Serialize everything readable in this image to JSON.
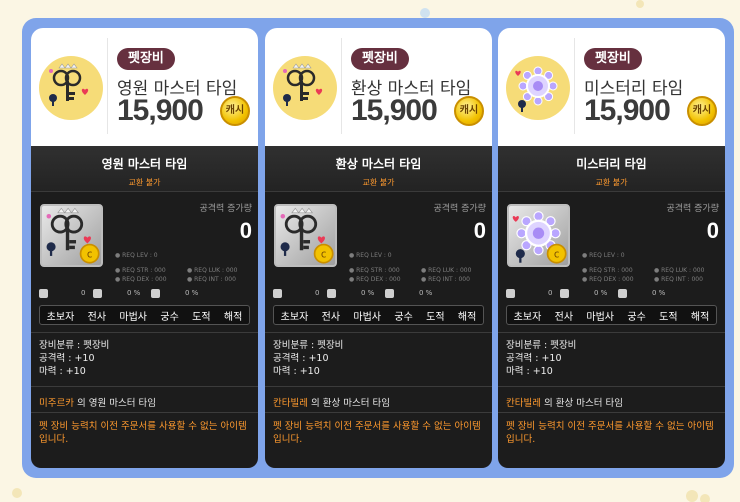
{
  "cards": [
    {
      "category": "펫장비",
      "item_name": "영원 마스터 타임",
      "price": "15,900",
      "currency": "캐시",
      "tooltip_name": "영원 마스터 타임",
      "trade": "교환 불가",
      "attack_label": "공격력 증가량",
      "attack_value": "0",
      "req_lev": "● REQ LEV :    0",
      "req_str": "● REQ STR : 000",
      "req_luk": "● REQ LUK : 000",
      "req_dex": "● REQ DEX : 000",
      "req_int": "● REQ INT : 000",
      "mini_values": [
        "0",
        "0 %",
        "0 %"
      ],
      "jobs": [
        "초보자",
        "전사",
        "마법사",
        "궁수",
        "도적",
        "해적"
      ],
      "stats": [
        "장비분류 : 펫장비",
        "공격력 : +10",
        "마력 : +10"
      ],
      "desc_owner": "미주르카",
      "desc_rest": " 의 영원 마스터 타임",
      "note": "펫 장비 능력치 이전 주문서를 사용할 수 없는 아이템입니다.",
      "icon": "key-icon",
      "icon_colors": {
        "thumb_bg": "#f6dc78",
        "accent": "#ffd84d"
      }
    },
    {
      "category": "펫장비",
      "item_name": "환상 마스터 타임",
      "price": "15,900",
      "currency": "캐시",
      "tooltip_name": "환상 마스터 타임",
      "trade": "교환 불가",
      "attack_label": "공격력 증가량",
      "attack_value": "0",
      "req_lev": "● REQ LEV :    0",
      "req_str": "● REQ STR : 000",
      "req_luk": "● REQ LUK : 000",
      "req_dex": "● REQ DEX : 000",
      "req_int": "● REQ INT : 000",
      "mini_values": [
        "0",
        "0 %",
        "0 %"
      ],
      "jobs": [
        "초보자",
        "전사",
        "마법사",
        "궁수",
        "도적",
        "해적"
      ],
      "stats": [
        "장비분류 : 펫장비",
        "공격력 : +10",
        "마력 : +10"
      ],
      "desc_owner": "칸타빌레",
      "desc_rest": " 의 환상 마스터 타임",
      "note": "펫 장비 능력치 이전 주문서를 사용할 수 없는 아이템입니다.",
      "icon": "key-icon",
      "icon_colors": {
        "thumb_bg": "#f6dc78",
        "accent": "#ffd84d"
      }
    },
    {
      "category": "펫장비",
      "item_name": "미스터리 타임",
      "price": "15,900",
      "currency": "캐시",
      "tooltip_name": "미스터리 타임",
      "trade": "교환 불가",
      "attack_label": "공격력 증가량",
      "attack_value": "0",
      "req_lev": "● REQ LEV :    0",
      "req_str": "● REQ STR : 000",
      "req_luk": "● REQ LUK : 000",
      "req_dex": "● REQ DEX : 000",
      "req_int": "● REQ INT : 000",
      "mini_values": [
        "0",
        "0 %",
        "0 %"
      ],
      "jobs": [
        "초보자",
        "전사",
        "마법사",
        "궁수",
        "도적",
        "해적"
      ],
      "stats": [
        "장비분류 : 펫장비",
        "공격력 : +10",
        "마력 : +10"
      ],
      "desc_owner": "칸타빌레",
      "desc_rest": " 의 환상 마스터 타임",
      "note": "펫 장비 능력치 이전 주문서를 사용할 수 없는 아이템입니다.",
      "icon": "gear-orb-icon",
      "icon_colors": {
        "thumb_bg": "#f6dc78",
        "accent": "#c9b8ff"
      }
    }
  ]
}
